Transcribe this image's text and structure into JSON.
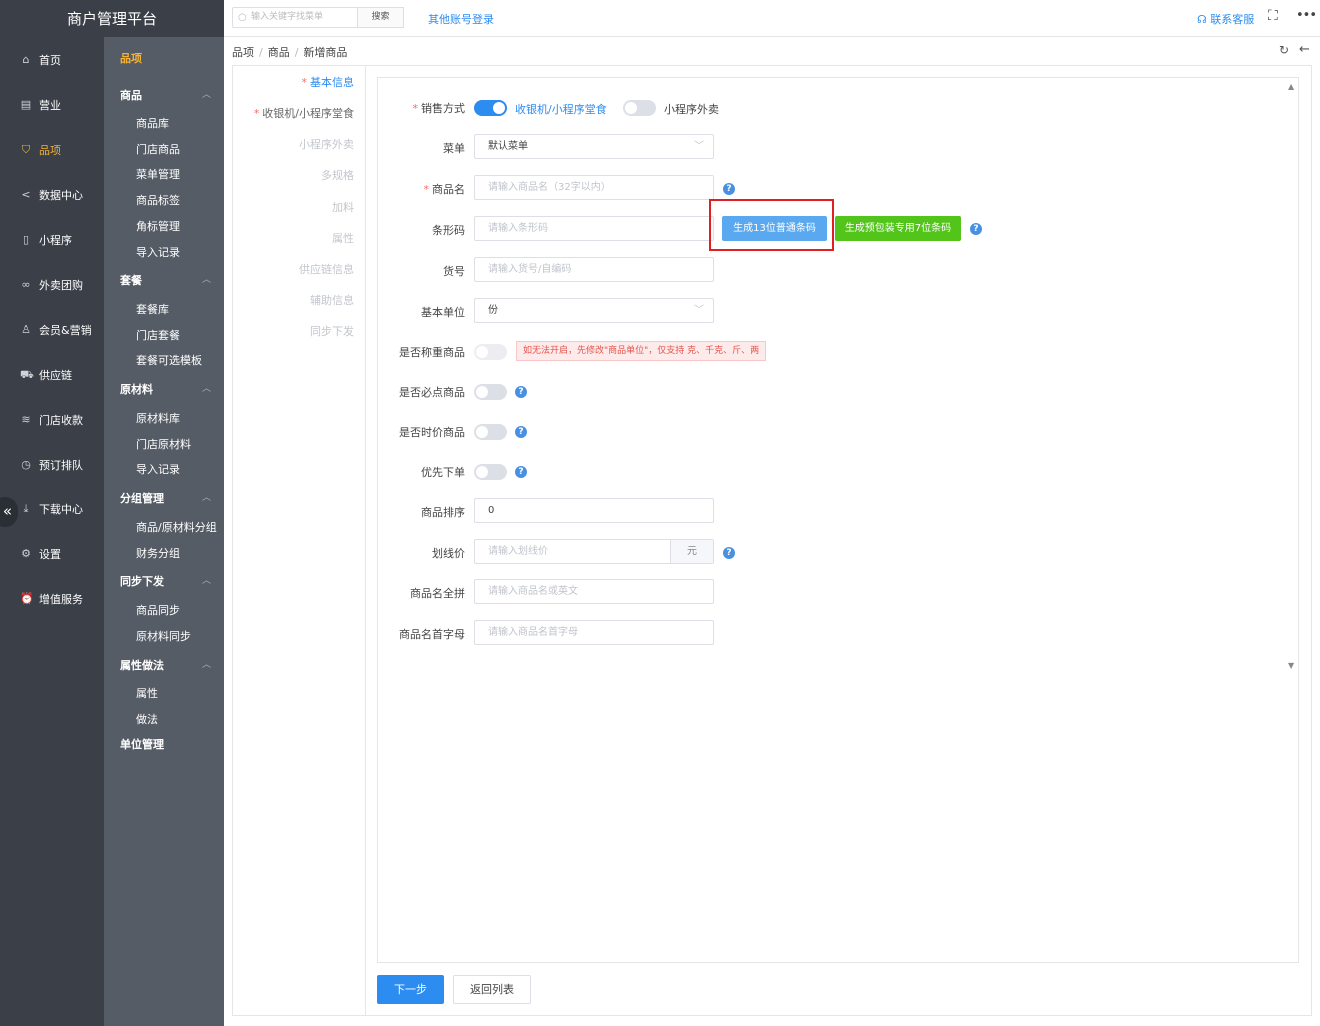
{
  "app_title": "商户管理平台",
  "sidebar": {
    "items": [
      {
        "label": "首页",
        "icon": "home-icon",
        "glyph": "⌂"
      },
      {
        "label": "营业",
        "icon": "calendar-icon",
        "glyph": "▤"
      },
      {
        "label": "品项",
        "icon": "bag-icon",
        "glyph": "⛉"
      },
      {
        "label": "数据中心",
        "icon": "share-icon",
        "glyph": "<"
      },
      {
        "label": "小程序",
        "icon": "phone-icon",
        "glyph": "▯"
      },
      {
        "label": "外卖团购",
        "icon": "bike-icon",
        "glyph": "∞"
      },
      {
        "label": "会员&营销",
        "icon": "user-icon",
        "glyph": "♙"
      },
      {
        "label": "供应链",
        "icon": "truck-icon",
        "glyph": "⛟"
      },
      {
        "label": "门店收款",
        "icon": "database-icon",
        "glyph": "≋"
      },
      {
        "label": "预订排队",
        "icon": "clock-icon",
        "glyph": "◷"
      },
      {
        "label": "下载中心",
        "icon": "download-icon",
        "glyph": "⤓"
      },
      {
        "label": "设置",
        "icon": "gear-icon",
        "glyph": "⚙"
      },
      {
        "label": "增值服务",
        "icon": "alarm-icon",
        "glyph": "⏰"
      }
    ],
    "collapse_glyph": "«"
  },
  "subnav": {
    "current": "品项",
    "groups": [
      {
        "label": "商品",
        "items": [
          "商品库",
          "门店商品",
          "菜单管理",
          "商品标签",
          "角标管理",
          "导入记录"
        ]
      },
      {
        "label": "套餐",
        "items": [
          "套餐库",
          "门店套餐",
          "套餐可选模板"
        ]
      },
      {
        "label": "原材料",
        "items": [
          "原材料库",
          "门店原材料",
          "导入记录"
        ]
      },
      {
        "label": "分组管理",
        "items": [
          "商品/原材料分组",
          "财务分组"
        ]
      },
      {
        "label": "同步下发",
        "items": [
          "商品同步",
          "原材料同步"
        ]
      },
      {
        "label": "属性做法",
        "items": [
          "属性",
          "做法"
        ]
      }
    ],
    "last": "单位管理"
  },
  "topbar": {
    "search_placeholder": "输入关键字找菜单",
    "search_button": "搜索",
    "other_login": "其他账号登录",
    "service": "联系客服"
  },
  "breadcrumb": [
    "品项",
    "商品",
    "新增商品"
  ],
  "steps": [
    {
      "label": "基本信息",
      "required": true,
      "state": "active"
    },
    {
      "label": "收银机/小程序堂食",
      "required": true,
      "state": "normal"
    },
    {
      "label": "小程序外卖",
      "required": false,
      "state": "disabled"
    },
    {
      "label": "多规格",
      "required": false,
      "state": "disabled"
    },
    {
      "label": "加料",
      "required": false,
      "state": "disabled"
    },
    {
      "label": "属性",
      "required": false,
      "state": "disabled"
    },
    {
      "label": "供应链信息",
      "required": false,
      "state": "disabled"
    },
    {
      "label": "辅助信息",
      "required": false,
      "state": "disabled"
    },
    {
      "label": "同步下发",
      "required": false,
      "state": "disabled"
    }
  ],
  "form": {
    "sale_mode": {
      "label": "销售方式",
      "opt1": "收银机/小程序堂食",
      "opt1_on": true,
      "opt2": "小程序外卖",
      "opt2_on": false
    },
    "menu": {
      "label": "菜单",
      "value": "默认菜单"
    },
    "name": {
      "label": "商品名",
      "placeholder": "请输入商品名（32字以内）"
    },
    "barcode": {
      "label": "条形码",
      "placeholder": "请输入条形码",
      "btn13": "生成13位普通条码",
      "btn7": "生成预包装专用7位条码"
    },
    "sku": {
      "label": "货号",
      "placeholder": "请输入货号/自编码"
    },
    "unit": {
      "label": "基本单位",
      "value": "份"
    },
    "weighed": {
      "label": "是否称重商品",
      "on": false,
      "tip": "如无法开启，先修改\"商品单位\"，仅支持 克、千克、斤、两"
    },
    "mandatory": {
      "label": "是否必点商品",
      "on": false
    },
    "seasonal": {
      "label": "是否时价商品",
      "on": false
    },
    "priority": {
      "label": "优先下单",
      "on": false
    },
    "sort": {
      "label": "商品排序",
      "value": "0"
    },
    "strike_price": {
      "label": "划线价",
      "placeholder": "请输入划线价",
      "suffix": "元"
    },
    "pinyin": {
      "label": "商品名全拼",
      "placeholder": "请输入商品名或英文"
    },
    "initials": {
      "label": "商品名首字母",
      "placeholder": "请输入商品名首字母"
    }
  },
  "footer": {
    "next": "下一步",
    "back": "返回列表"
  },
  "colors": {
    "sidebar": "#3a3f48",
    "subnav": "#565c66",
    "accent": "#f5b335",
    "primary": "#2d8cf0",
    "green": "#52c41a",
    "highlight": "#e02020"
  }
}
